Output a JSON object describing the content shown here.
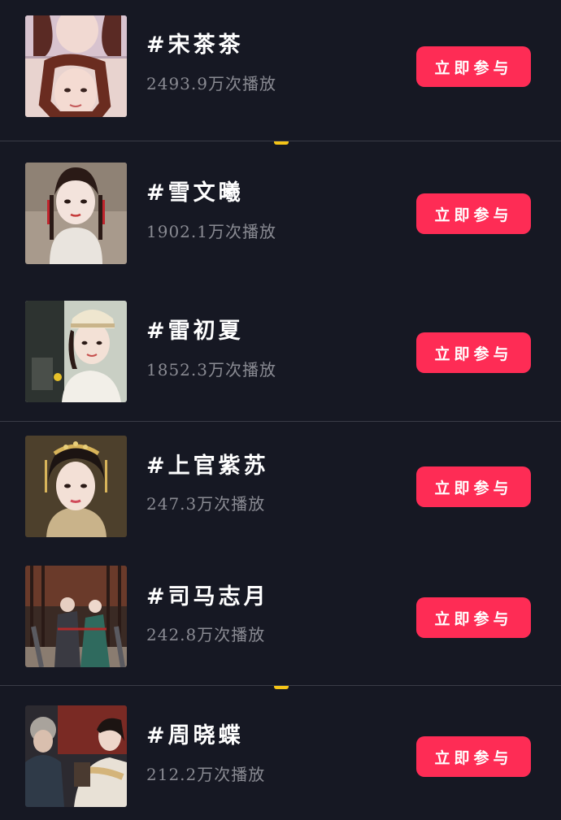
{
  "colors": {
    "background": "#161823",
    "button": "#fe2c55",
    "title": "#ffffff",
    "subtitle": "#8a8b93",
    "divider": "#3a3c47",
    "notch": "#f5c518"
  },
  "items": [
    {
      "title": "#宋茶茶",
      "plays": "2493.9万次播放",
      "button": "立即参与",
      "thumbnail": "portrait-photo"
    },
    {
      "title": "#雪文曦",
      "plays": "1902.1万次播放",
      "button": "立即参与",
      "thumbnail": "portrait-photo"
    },
    {
      "title": "#雷初夏",
      "plays": "1852.3万次播放",
      "button": "立即参与",
      "thumbnail": "portrait-photo"
    },
    {
      "title": "#上官紫苏",
      "plays": "247.3万次播放",
      "button": "立即参与",
      "thumbnail": "portrait-photo"
    },
    {
      "title": "#司马志月",
      "plays": "242.8万次播放",
      "button": "立即参与",
      "thumbnail": "scene-photo"
    },
    {
      "title": "#周晓蝶",
      "plays": "212.2万次播放",
      "button": "立即参与",
      "thumbnail": "scene-photo"
    }
  ]
}
